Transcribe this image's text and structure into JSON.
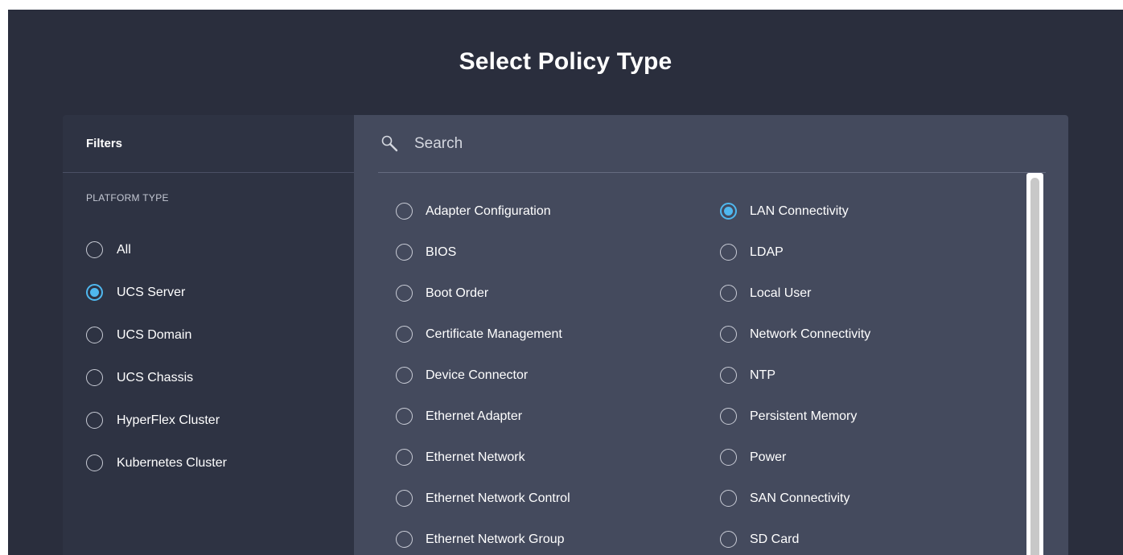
{
  "title": "Select Policy Type",
  "filters": {
    "header": "Filters",
    "section_label": "PLATFORM TYPE",
    "options": [
      {
        "label": "All",
        "checked": false
      },
      {
        "label": "UCS Server",
        "checked": true
      },
      {
        "label": "UCS Domain",
        "checked": false
      },
      {
        "label": "UCS Chassis",
        "checked": false
      },
      {
        "label": "HyperFlex Cluster",
        "checked": false
      },
      {
        "label": "Kubernetes Cluster",
        "checked": false
      }
    ]
  },
  "search": {
    "placeholder": "Search",
    "icon": "search-icon"
  },
  "policies": {
    "left": [
      {
        "label": "Adapter Configuration",
        "checked": false
      },
      {
        "label": "BIOS",
        "checked": false
      },
      {
        "label": "Boot Order",
        "checked": false
      },
      {
        "label": "Certificate Management",
        "checked": false
      },
      {
        "label": "Device Connector",
        "checked": false
      },
      {
        "label": "Ethernet Adapter",
        "checked": false
      },
      {
        "label": "Ethernet Network",
        "checked": false
      },
      {
        "label": "Ethernet Network Control",
        "checked": false
      },
      {
        "label": "Ethernet Network Group",
        "checked": false
      }
    ],
    "right": [
      {
        "label": "LAN Connectivity",
        "checked": true
      },
      {
        "label": "LDAP",
        "checked": false
      },
      {
        "label": "Local User",
        "checked": false
      },
      {
        "label": "Network Connectivity",
        "checked": false
      },
      {
        "label": "NTP",
        "checked": false
      },
      {
        "label": "Persistent Memory",
        "checked": false
      },
      {
        "label": "Power",
        "checked": false
      },
      {
        "label": "SAN Connectivity",
        "checked": false
      },
      {
        "label": "SD Card",
        "checked": false
      }
    ]
  },
  "colors": {
    "background": "#2a2e3d",
    "filters_panel": "#2e3343",
    "results_panel": "#444a5d",
    "accent": "#4fb8ef"
  }
}
